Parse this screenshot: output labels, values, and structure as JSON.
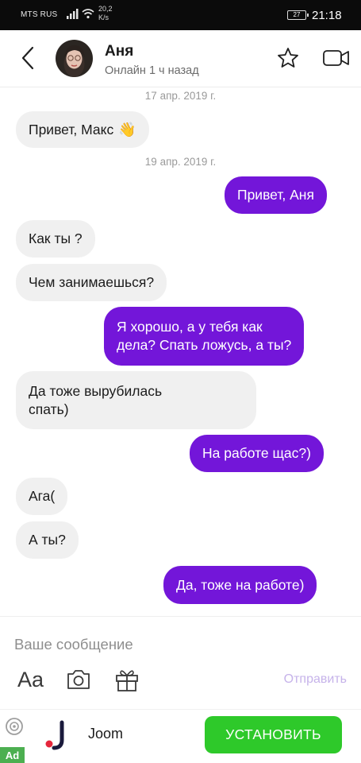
{
  "status_bar": {
    "carrier": "MTS RUS",
    "speed_value": "20,2",
    "speed_unit": "K/s",
    "battery": "27",
    "time": "21:18"
  },
  "header": {
    "contact_name": "Аня",
    "contact_status": "Онлайн 1 ч назад",
    "back_icon": "chevron-left-icon",
    "star_icon": "star-outline-icon",
    "video_icon": "video-camera-icon"
  },
  "chat": {
    "date_1": "17 апр. 2019 г.",
    "date_2": "19 апр. 2019 г.",
    "messages": [
      {
        "dir": "in",
        "text": "Привет, Макс",
        "emoji": "👋"
      },
      {
        "dir": "out",
        "text": "Привет, Аня"
      },
      {
        "dir": "in",
        "text": "Как ты ?"
      },
      {
        "dir": "in",
        "text": "Чем занимаешься?"
      },
      {
        "dir": "out",
        "line1": "Я хорошо, а у тебя как",
        "line2": "дела? Спать ложусь, а ты?"
      },
      {
        "dir": "in",
        "line1": "Да тоже вырубилась",
        "line2": "спать)"
      },
      {
        "dir": "out",
        "text": "На работе щас?)"
      },
      {
        "dir": "in",
        "text": "Ага("
      },
      {
        "dir": "in",
        "text": "А ты?"
      },
      {
        "dir": "out",
        "text": "Да, тоже на работе)"
      }
    ]
  },
  "composer": {
    "placeholder": "Ваше сообщение",
    "font_tool_label": "Aa",
    "send_label": "Отправить",
    "camera_icon": "camera-icon",
    "gift_icon": "gift-icon"
  },
  "ad": {
    "brand": "Joom",
    "cta": "УСТАНОВИТЬ",
    "label": "Ad"
  },
  "colors": {
    "accent": "#7316d9",
    "incoming_bubble": "#f0f0f0",
    "cta_green": "#2ec92a",
    "ad_label_green": "#4caf50"
  }
}
